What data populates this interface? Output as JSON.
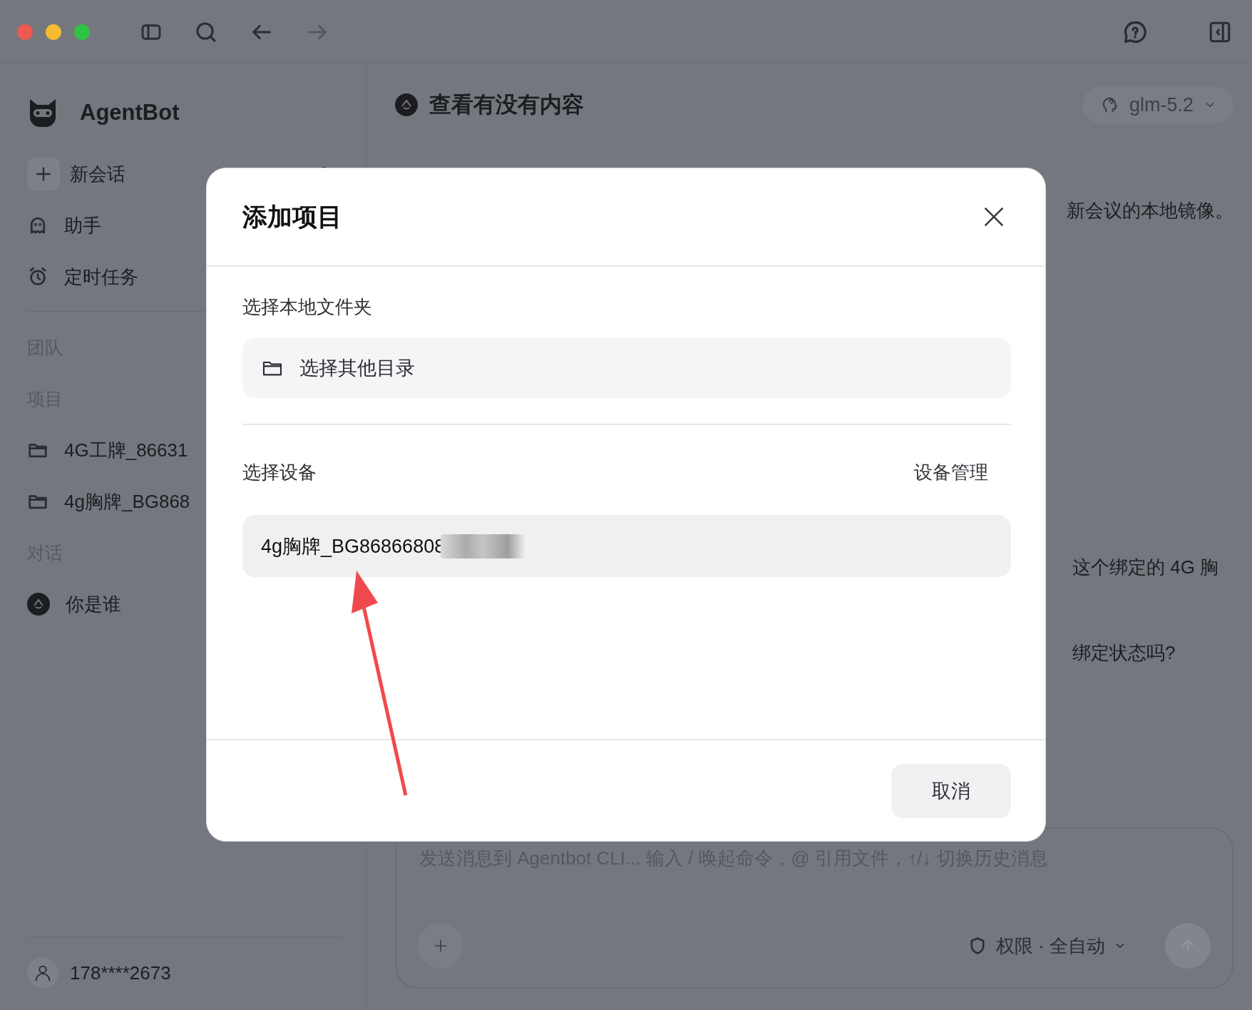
{
  "sidebar": {
    "app_name": "AgentBot",
    "actions": [
      {
        "kind": "new",
        "label": "新会话"
      },
      {
        "kind": "assistant",
        "label": "助手"
      },
      {
        "kind": "schedule",
        "label": "定时任务"
      }
    ],
    "sections": [
      {
        "title": "团队"
      },
      {
        "title": "项目",
        "items": [
          {
            "kind": "folder",
            "label": "4G工牌_86631"
          },
          {
            "kind": "folder",
            "label": "4g胸牌_BG868"
          }
        ]
      },
      {
        "title": "对话",
        "items": [
          {
            "kind": "chat",
            "label": "你是谁"
          }
        ]
      }
    ],
    "user": "178****2673"
  },
  "main": {
    "title": "查看有没有内容",
    "model": "glm-5.2",
    "fragments": [
      {
        "text": "新会议的本地镜像。"
      },
      {
        "text": "这个绑定的 4G 胸"
      },
      {
        "text": "绑定状态吗?"
      }
    ],
    "composer": {
      "placeholder": "发送消息到 Agentbot CLI... 输入 / 唤起命令，@ 引用文件，↑/↓ 切换历史消息",
      "permission": "权限 · 全自动"
    }
  },
  "dialog": {
    "title": "添加项目",
    "folder_label": "选择本地文件夹",
    "folder_button": "选择其他目录",
    "device_label": "选择设备",
    "device_link": "设备管理",
    "device_value": "4g胸牌_BG86866808",
    "buttons": [
      "取消"
    ]
  }
}
